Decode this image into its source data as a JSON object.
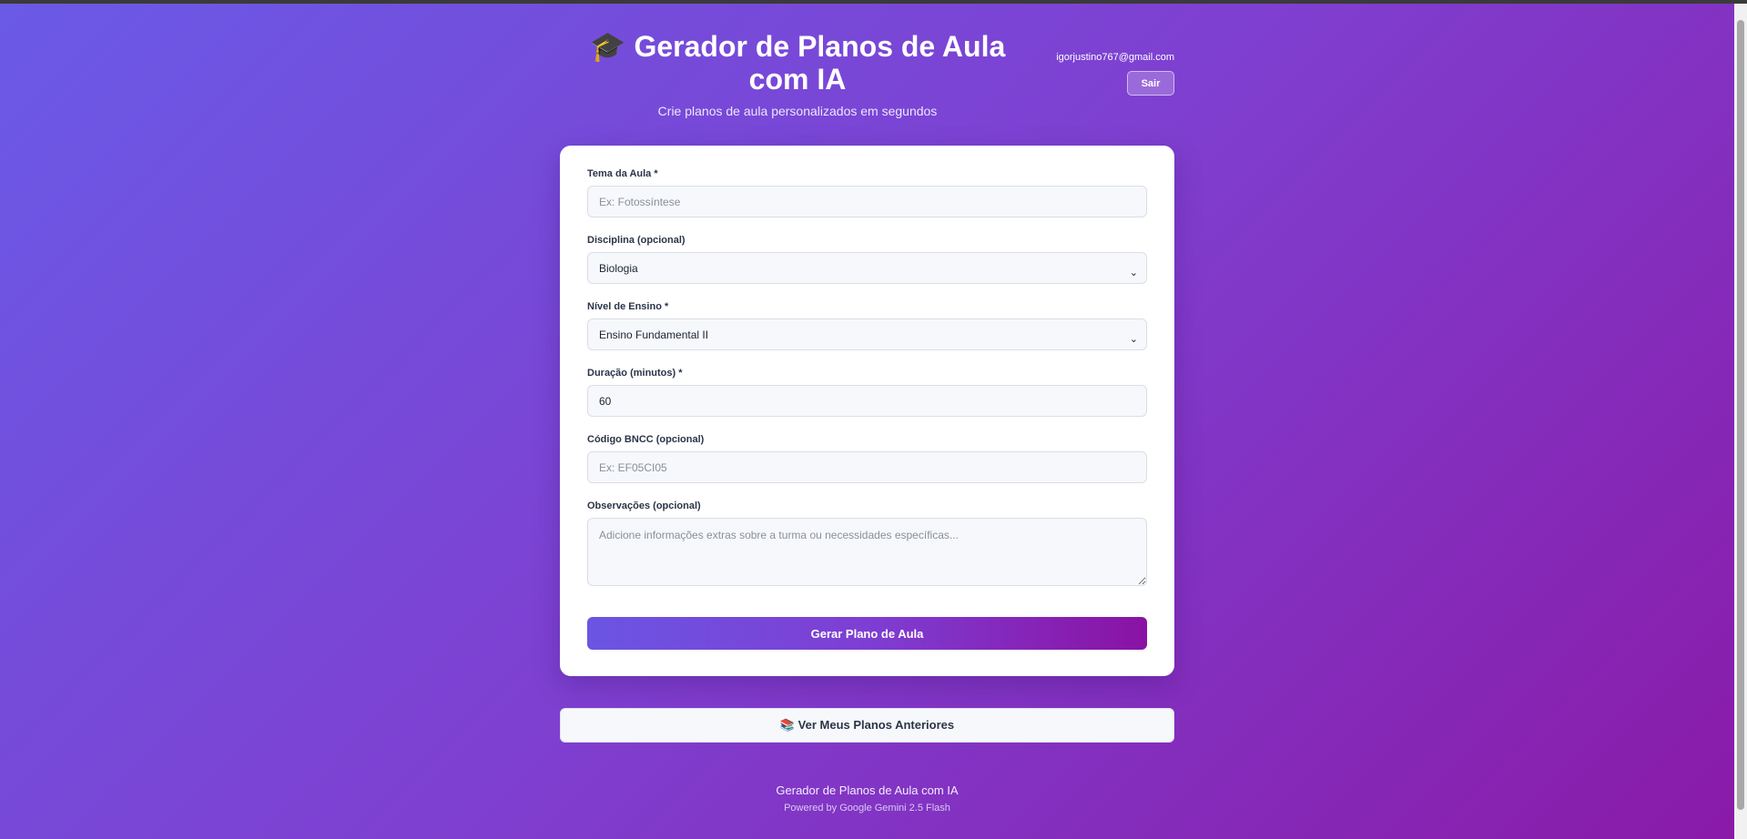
{
  "header": {
    "title": "🎓 Gerador de Planos de Aula com IA",
    "subtitle": "Crie planos de aula personalizados em segundos",
    "user_email": "igorjustino767@gmail.com",
    "logout_label": "Sair"
  },
  "form": {
    "topic": {
      "label": "Tema da Aula *",
      "placeholder": "Ex: Fotossíntese",
      "value": ""
    },
    "subject": {
      "label": "Disciplina (opcional)",
      "selected": "Biologia"
    },
    "level": {
      "label": "Nível de Ensino *",
      "selected": "Ensino Fundamental II"
    },
    "duration": {
      "label": "Duração (minutos) *",
      "value": "60"
    },
    "bncc": {
      "label": "Código BNCC (opcional)",
      "placeholder": "Ex: EF05CI05",
      "value": ""
    },
    "notes": {
      "label": "Observações (opcional)",
      "placeholder": "Adicione informações extras sobre a turma ou necessidades específicas...",
      "value": ""
    },
    "submit_label": "Gerar Plano de Aula"
  },
  "history_button_label": "📚 Ver Meus Planos Anteriores",
  "footer": {
    "title": "Gerador de Planos de Aula com IA",
    "powered_by": "Powered by Google Gemini 2.5 Flash"
  },
  "colors": {
    "gradient_start": "#6a5ae6",
    "gradient_end": "#8a1aa8",
    "card": "#ffffff"
  }
}
